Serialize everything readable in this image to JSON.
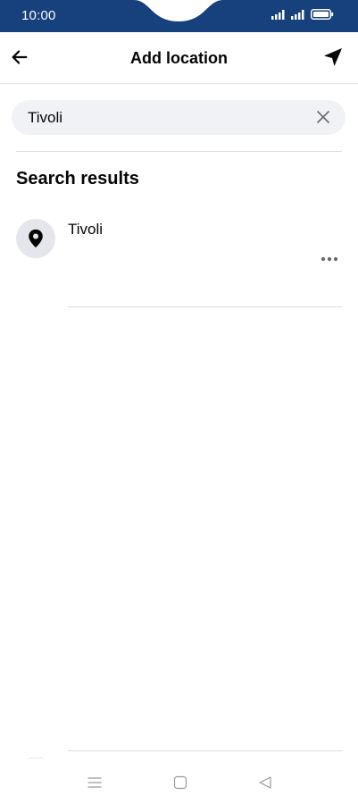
{
  "status_bar": {
    "time": "10:00",
    "background": "#17417c",
    "icons": [
      "signal-icon",
      "signal-icon",
      "battery-icon"
    ]
  },
  "header": {
    "title": "Add location",
    "back_icon": "arrow-left-icon",
    "action_icon": "navigation-arrow-icon"
  },
  "search": {
    "value": "Tivoli",
    "clear_icon": "close-icon"
  },
  "results": {
    "heading": "Search results",
    "items": [
      {
        "name": "Tivoli",
        "icon": "map-pin-icon",
        "more_icon": "more-horizontal-icon"
      }
    ]
  },
  "nav_bar": {
    "icons": [
      "menu-icon",
      "home-square-icon",
      "back-triangle-icon"
    ]
  }
}
